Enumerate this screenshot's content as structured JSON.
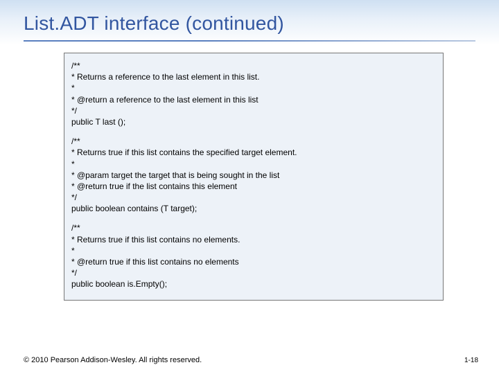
{
  "title": "List.ADT interface (continued)",
  "code": {
    "block1": {
      "l1": "/**",
      "l2": "  * Returns a reference to the last element in this list.",
      "l3": "  *",
      "l4": "  * @return  a reference to the last element in this list",
      "l5": "  */",
      "l6": "  public T last ();"
    },
    "block2": {
      "l1": "/**",
      "l2": "  * Returns true if this list contains the specified target element.",
      "l3": "  *",
      "l4": "  * @param target  the target that is being sought in the list",
      "l5": "  * @return        true if the list contains this element",
      "l6": "  */",
      "l7": "  public boolean contains (T target);"
    },
    "block3": {
      "l1": "/**",
      "l2": "  * Returns true if this list contains no elements.",
      "l3": "  *",
      "l4": "  * @return  true if this list contains no elements",
      "l5": "  */",
      "l6": "  public boolean is.Empty();"
    }
  },
  "footer": "© 2010 Pearson Addison-Wesley. All rights reserved.",
  "pagenum": "1-18"
}
